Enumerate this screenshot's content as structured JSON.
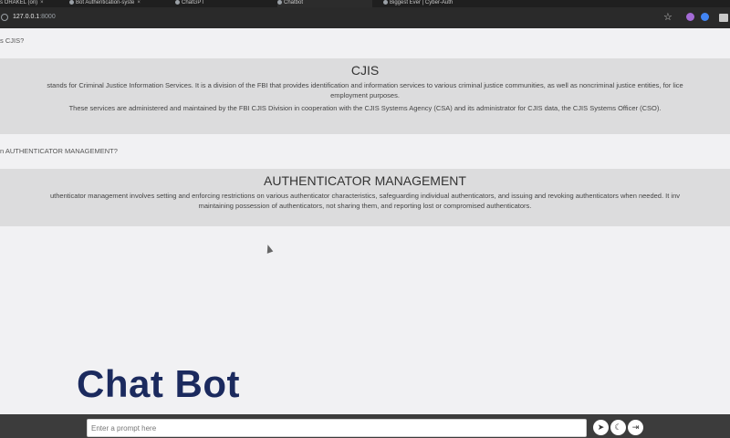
{
  "browser": {
    "tabs": [
      {
        "label": "s ORAKEL (ori)"
      },
      {
        "label": "Bot Authentication-syste"
      },
      {
        "label": "ChatGPT"
      },
      {
        "label": "Chatbot"
      },
      {
        "label": "Biggest Ever | Cyber-Auth"
      }
    ],
    "url_host": "127.0.0.1",
    "url_port": ":8000"
  },
  "chat": {
    "q1": "s CJIS?",
    "a1": {
      "title": "CJIS",
      "line1": "stands for Criminal Justice Information Services. It is a division of the FBI that provides identification and information services to various criminal justice communities, as well as noncriminal justice entities, for lice",
      "line2": "employment purposes.",
      "line3": "These services are administered and maintained by the FBI CJIS Division in cooperation with the CJIS Systems Agency (CSA) and its administrator for CJIS data, the CJIS Systems Officer (CSO)."
    },
    "q2": "n AUTHENTICATOR MANAGEMENT?",
    "a2": {
      "title": "AUTHENTICATOR MANAGEMENT",
      "line1": "uthenticator management involves setting and enforcing restrictions on various authenticator characteristics, safeguarding individual authenticators, and issuing and revoking authenticators when needed. It inv",
      "line2": "maintaining possession of authenticators, not sharing them, and reporting lost or compromised authenticators."
    }
  },
  "brand": "Chat Bot",
  "input": {
    "placeholder": "Enter a prompt here",
    "send_icon": "send-icon",
    "theme_icon": "moon-icon",
    "logout_icon": "logout-icon"
  },
  "colors": {
    "brand": "#1b2a5e",
    "answer_bg": "#dcdcdd",
    "page_bg": "#f1f1f3"
  }
}
